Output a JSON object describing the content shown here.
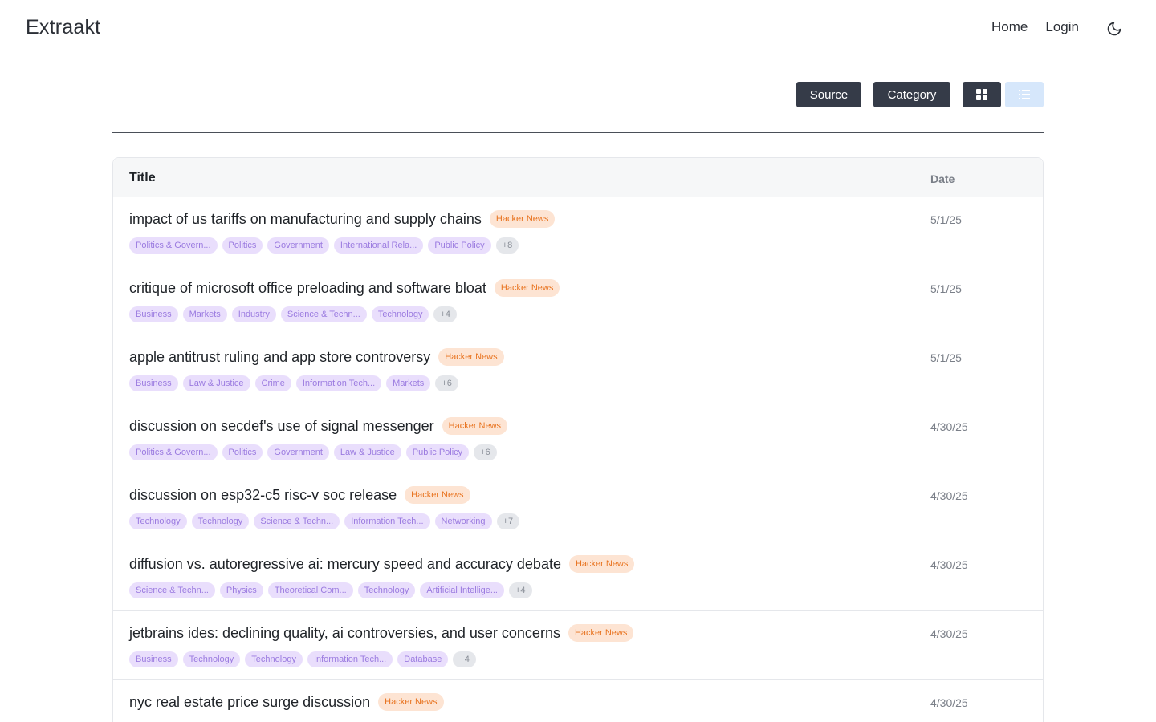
{
  "brand": "Extraakt",
  "nav": {
    "home": "Home",
    "login": "Login"
  },
  "toolbar": {
    "source": "Source",
    "category": "Category"
  },
  "table": {
    "title_header": "Title",
    "date_header": "Date"
  },
  "rows": [
    {
      "title": "impact of us tariffs on manufacturing and supply chains",
      "source": "Hacker News",
      "date": "5/1/25",
      "tags": [
        "Politics & Govern...",
        "Politics",
        "Government",
        "International Rela...",
        "Public Policy"
      ],
      "more": "+8"
    },
    {
      "title": "critique of microsoft office preloading and software bloat",
      "source": "Hacker News",
      "date": "5/1/25",
      "tags": [
        "Business",
        "Markets",
        "Industry",
        "Science & Techn...",
        "Technology"
      ],
      "more": "+4"
    },
    {
      "title": "apple antitrust ruling and app store controversy",
      "source": "Hacker News",
      "date": "5/1/25",
      "tags": [
        "Business",
        "Law & Justice",
        "Crime",
        "Information Tech...",
        "Markets"
      ],
      "more": "+6"
    },
    {
      "title": "discussion on secdef's use of signal messenger",
      "source": "Hacker News",
      "date": "4/30/25",
      "tags": [
        "Politics & Govern...",
        "Politics",
        "Government",
        "Law & Justice",
        "Public Policy"
      ],
      "more": "+6"
    },
    {
      "title": "discussion on esp32-c5 risc-v soc release",
      "source": "Hacker News",
      "date": "4/30/25",
      "tags": [
        "Technology",
        "Technology",
        "Science & Techn...",
        "Information Tech...",
        "Networking"
      ],
      "more": "+7"
    },
    {
      "title": "diffusion vs. autoregressive ai: mercury speed and accuracy debate",
      "source": "Hacker News",
      "date": "4/30/25",
      "tags": [
        "Science & Techn...",
        "Physics",
        "Theoretical Com...",
        "Technology",
        "Artificial Intellige..."
      ],
      "more": "+4"
    },
    {
      "title": "jetbrains ides: declining quality, ai controversies, and user concerns",
      "source": "Hacker News",
      "date": "4/30/25",
      "tags": [
        "Business",
        "Technology",
        "Technology",
        "Information Tech...",
        "Database"
      ],
      "more": "+4"
    },
    {
      "title": "nyc real estate price surge discussion",
      "source": "Hacker News",
      "date": "4/30/25",
      "tags": [],
      "more": ""
    }
  ],
  "icons": {
    "theme": "moon-icon",
    "grid": "grid-icon",
    "list": "list-icon"
  }
}
